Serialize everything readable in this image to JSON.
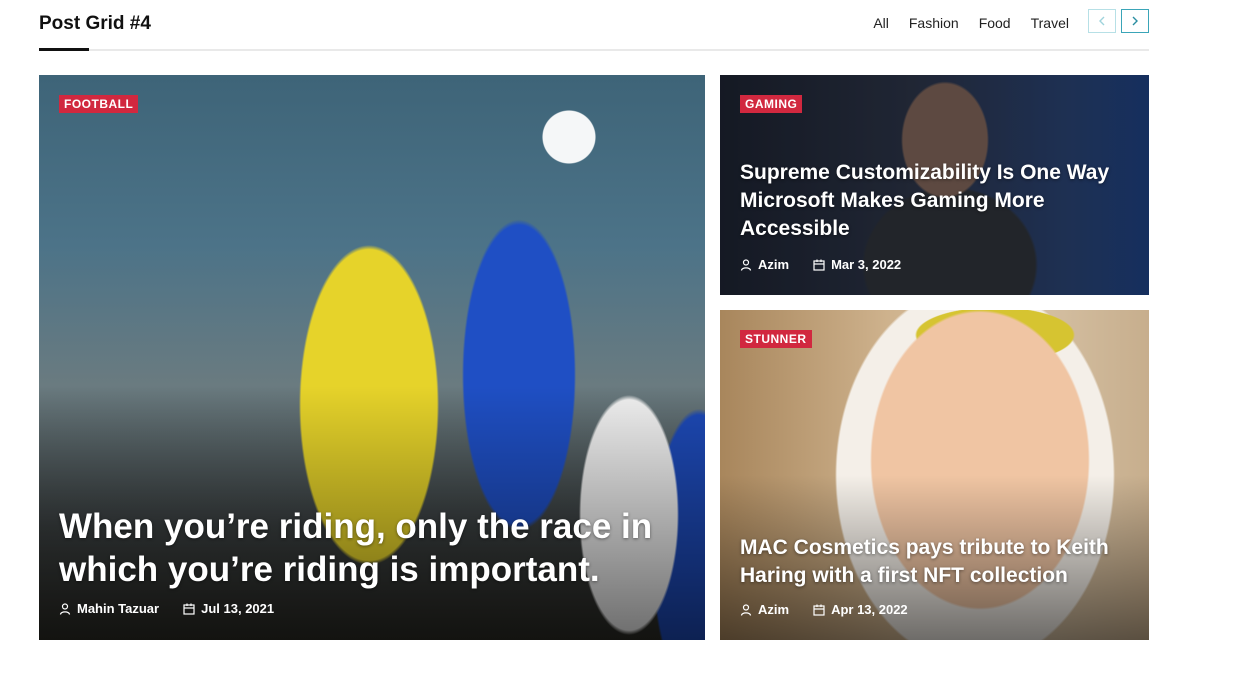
{
  "header": {
    "title": "Post Grid #4",
    "filters": [
      "All",
      "Fashion",
      "Food",
      "Travel"
    ]
  },
  "posts": [
    {
      "category": "FOOTBALL",
      "title": "When you’re riding, only the race in which you’re riding is important.",
      "author": "Mahin Tazuar",
      "date": "Jul 13, 2021"
    },
    {
      "category": "GAMING",
      "title": "Supreme Customizability Is One Way Microsoft Makes Gaming More Accessible",
      "author": "Azim",
      "date": "Mar 3, 2022"
    },
    {
      "category": "STUNNER",
      "title": "MAC Cosmetics pays tribute to Keith Haring with a first NFT collection",
      "author": "Azim",
      "date": "Apr 13, 2022"
    }
  ],
  "colors": {
    "badge": "#d1283f",
    "nav_border": "#3aa5b8"
  },
  "icons": {
    "prev": "chevron-left-icon",
    "next": "chevron-right-icon",
    "author": "user-icon",
    "date": "calendar-icon"
  }
}
